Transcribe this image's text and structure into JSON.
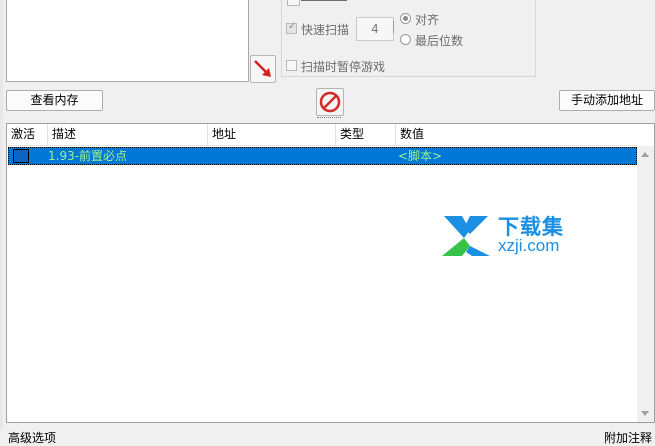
{
  "scan_options": {
    "fast_scan_label": "快速扫描",
    "fast_scan_value": "4",
    "align_label": "对齐",
    "last_digits_label": "最后位数",
    "pause_label": "扫描时暂停游戏"
  },
  "buttons": {
    "view_memory": "查看内存",
    "add_address_manually": "手动添加地址"
  },
  "table": {
    "columns": [
      "激活",
      "描述",
      "地址",
      "类型",
      "数值"
    ],
    "rows": [
      {
        "active": false,
        "description": "1.93-前置必点",
        "address": "",
        "type": "",
        "value": "<脚本>"
      }
    ]
  },
  "footer": {
    "advanced_options": "高级选项",
    "add_comment": "附加注释"
  },
  "watermark": {
    "cn": "下载集",
    "url": "xzji.com"
  },
  "colors": {
    "selected_row": "#0078d7",
    "script_text": "#9ef48c",
    "watermark_blue": "#1a8fe3"
  }
}
